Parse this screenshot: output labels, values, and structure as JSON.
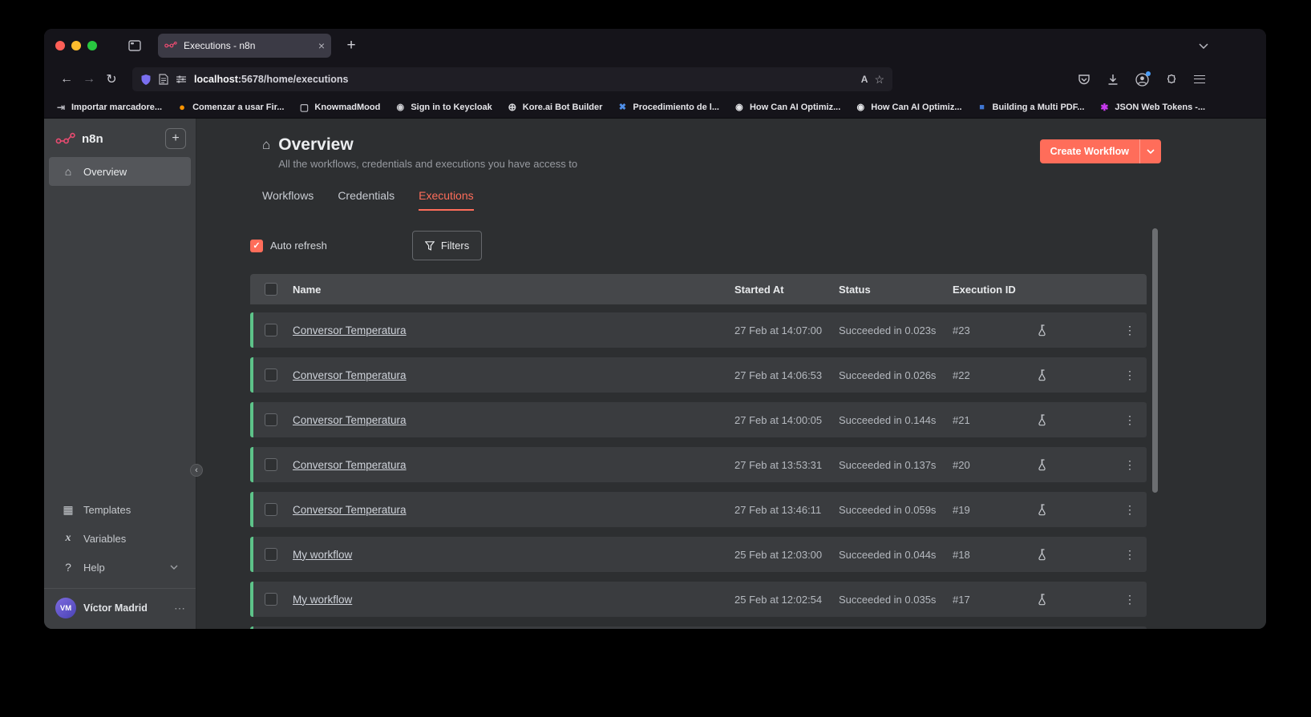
{
  "colors": {
    "accent": "#ff6d5a",
    "success_strip": "#5dc389",
    "logo": "#ea4b71",
    "chrome_bg": "#15141a",
    "app_bg": "#2d2f31"
  },
  "icons": {
    "close": "×",
    "plus": "+",
    "kebab": "⋮",
    "check": "✓",
    "star": "☆",
    "home": "⌂",
    "back": "←",
    "forward": "→",
    "reload": "↻",
    "collapse": "‹",
    "more": "⋯",
    "templates": "▦",
    "variables": "x",
    "help": "?",
    "translate": "A"
  },
  "browser": {
    "tab_title": "Executions - n8n",
    "url_host": "localhost",
    "url_rest": ":5678/home/executions",
    "bookmarks": [
      {
        "label": "Importar marcadore...",
        "icon": "import"
      },
      {
        "label": "Comenzar a usar Fir...",
        "icon": "firefox"
      },
      {
        "label": "KnowmadMood",
        "icon": "folder"
      },
      {
        "label": "Sign in to Keycloak",
        "icon": "keycloak"
      },
      {
        "label": "Kore.ai Bot Builder",
        "icon": "globe"
      },
      {
        "label": "Procedimiento de l...",
        "icon": "procedure"
      },
      {
        "label": "How Can AI Optimiz...",
        "icon": "medium"
      },
      {
        "label": "How Can AI Optimiz...",
        "icon": "medium"
      },
      {
        "label": "Building a Multi PDF...",
        "icon": "pdf"
      },
      {
        "label": "JSON Web Tokens -...",
        "icon": "jwt"
      }
    ]
  },
  "sidebar": {
    "logo_text": "n8n",
    "overview_label": "Overview",
    "templates_label": "Templates",
    "variables_label": "Variables",
    "help_label": "Help",
    "user_name": "Víctor Madrid",
    "user_initials": "VM"
  },
  "main": {
    "title": "Overview",
    "subtitle": "All the workflows, credentials and executions you have access to",
    "create_workflow_label": "Create Workflow",
    "tabs": {
      "workflows": "Workflows",
      "credentials": "Credentials",
      "executions": "Executions"
    },
    "active_tab": "Executions",
    "auto_refresh_label": "Auto refresh",
    "filters_label": "Filters",
    "table": {
      "headers": {
        "name": "Name",
        "started": "Started At",
        "status": "Status",
        "id": "Execution ID"
      },
      "rows": [
        {
          "name": "Conversor Temperatura",
          "started": "27 Feb at 14:07:00",
          "status": "Succeeded in 0.023s",
          "id": "#23"
        },
        {
          "name": "Conversor Temperatura",
          "started": "27 Feb at 14:06:53",
          "status": "Succeeded in 0.026s",
          "id": "#22"
        },
        {
          "name": "Conversor Temperatura",
          "started": "27 Feb at 14:00:05",
          "status": "Succeeded in 0.144s",
          "id": "#21"
        },
        {
          "name": "Conversor Temperatura",
          "started": "27 Feb at 13:53:31",
          "status": "Succeeded in 0.137s",
          "id": "#20"
        },
        {
          "name": "Conversor Temperatura",
          "started": "27 Feb at 13:46:11",
          "status": "Succeeded in 0.059s",
          "id": "#19"
        },
        {
          "name": "My workflow",
          "started": "25 Feb at 12:03:00",
          "status": "Succeeded in 0.044s",
          "id": "#18"
        },
        {
          "name": "My workflow",
          "started": "25 Feb at 12:02:54",
          "status": "Succeeded in 0.035s",
          "id": "#17"
        }
      ]
    }
  }
}
